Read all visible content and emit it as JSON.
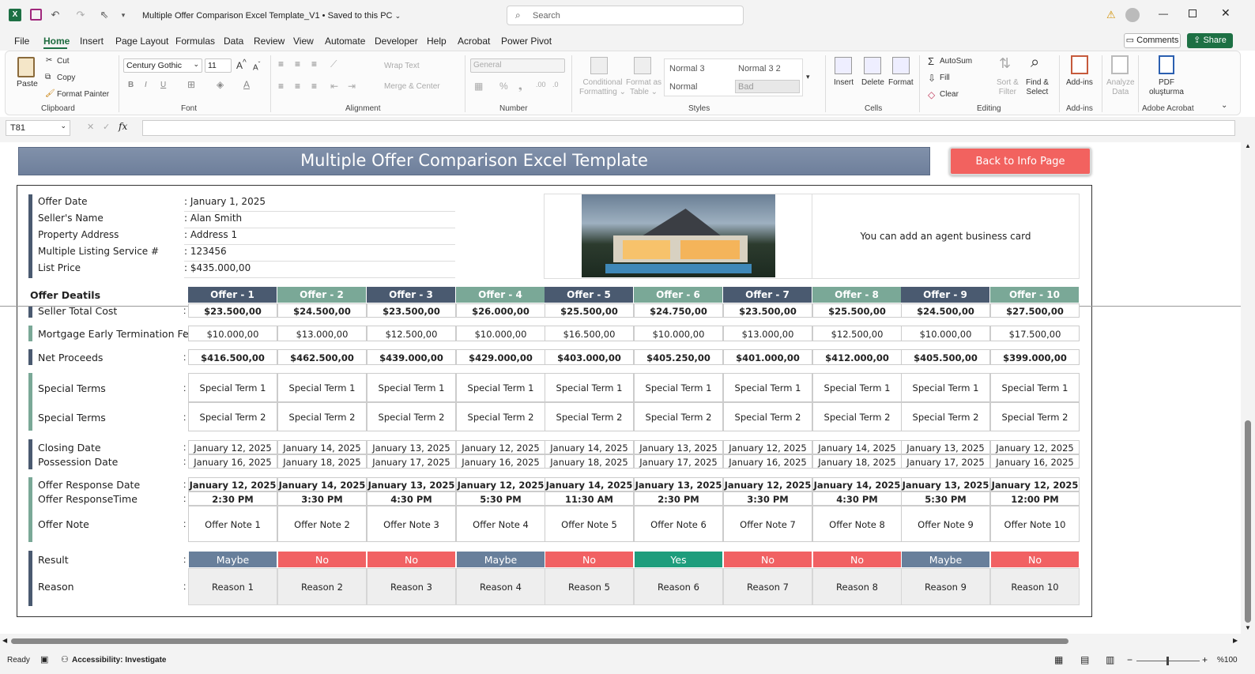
{
  "titlebar": {
    "doc_title": "Multiple Offer Comparison Excel Template_V1",
    "saved_status": "Saved to this PC",
    "search_placeholder": "Search"
  },
  "menu": [
    "File",
    "Home",
    "Insert",
    "Page Layout",
    "Formulas",
    "Data",
    "Review",
    "View",
    "Automate",
    "Developer",
    "Help",
    "Acrobat",
    "Power Pivot"
  ],
  "menu_active": "Home",
  "comments_label": "Comments",
  "share_label": "Share",
  "ribbon": {
    "clipboard": {
      "paste": "Paste",
      "cut": "Cut",
      "copy": "Copy",
      "format_painter": "Format Painter",
      "group": "Clipboard"
    },
    "font": {
      "name": "Century Gothic",
      "size": "11",
      "group": "Font"
    },
    "alignment": {
      "wrap": "Wrap Text",
      "merge": "Merge & Center",
      "group": "Alignment"
    },
    "number": {
      "format": "General",
      "group": "Number"
    },
    "styles": {
      "cond1": "Conditional",
      "cond2": "Formatting",
      "fmt1": "Format as",
      "fmt2": "Table",
      "s1": "Normal 3",
      "s2": "Normal 3 2",
      "s3": "Normal",
      "s4": "Bad",
      "group": "Styles"
    },
    "cells": {
      "insert": "Insert",
      "delete": "Delete",
      "format": "Format",
      "group": "Cells"
    },
    "editing": {
      "autosum": "AutoSum",
      "fill": "Fill",
      "clear": "Clear",
      "sort1": "Sort &",
      "sort2": "Filter",
      "find1": "Find &",
      "find2": "Select",
      "group": "Editing"
    },
    "addins": {
      "label": "Add-ins",
      "group": "Add-ins"
    },
    "analyze": {
      "l1": "Analyze",
      "l2": "Data"
    },
    "acrobat": {
      "l1": "PDF",
      "l2": "oluşturma",
      "group": "Adobe Acrobat"
    }
  },
  "namebox": "T81",
  "fx": "fx",
  "sheet": {
    "banner_title": "Multiple Offer Comparison Excel Template",
    "back_button": "Back to Info Page",
    "agent_card_text": "You can add an agent business card",
    "info": [
      {
        "label": "Offer Date",
        "value": ": January 1, 2025"
      },
      {
        "label": "Seller's Name",
        "value": ": Alan Smith"
      },
      {
        "label": "Property Address",
        "value": ": Address 1"
      },
      {
        "label": "Multiple Listing Service #",
        "value": ": 123456"
      },
      {
        "label": "List Price",
        "value": ": $435.000,00"
      }
    ],
    "offer_details_label": "Offer Deatils",
    "offers": [
      "Offer - 1",
      "Offer - 2",
      "Offer - 3",
      "Offer - 4",
      "Offer - 5",
      "Offer - 6",
      "Offer - 7",
      "Offer - 8",
      "Offer - 9",
      "Offer - 10"
    ],
    "colors": {
      "dark": "#4a5a70",
      "teal": "#7aa897",
      "banner": "#7a8aa5",
      "red": "#f16163",
      "green": "#1e9d7c",
      "maybe": "#687f9b"
    },
    "rows": {
      "seller_total_cost": {
        "label": "Seller Total Cost",
        "values": [
          "$23.500,00",
          "$24.500,00",
          "$23.500,00",
          "$26.000,00",
          "$25.500,00",
          "$24.750,00",
          "$23.500,00",
          "$25.500,00",
          "$24.500,00",
          "$27.500,00"
        ]
      },
      "mortgage_fee": {
        "label": "Mortgage Early Termination Fee",
        "values": [
          "$10.000,00",
          "$13.000,00",
          "$12.500,00",
          "$10.000,00",
          "$16.500,00",
          "$10.000,00",
          "$13.000,00",
          "$12.500,00",
          "$10.000,00",
          "$17.500,00"
        ]
      },
      "net_proceeds": {
        "label": "Net Proceeds",
        "values": [
          "$416.500,00",
          "$462.500,00",
          "$439.000,00",
          "$429.000,00",
          "$403.000,00",
          "$405.250,00",
          "$401.000,00",
          "$412.000,00",
          "$405.500,00",
          "$399.000,00"
        ]
      },
      "special1": {
        "label": "Special Terms",
        "values": [
          "Special Term 1",
          "Special Term 1",
          "Special Term 1",
          "Special Term 1",
          "Special Term 1",
          "Special Term 1",
          "Special Term 1",
          "Special Term 1",
          "Special Term 1",
          "Special Term 1"
        ]
      },
      "special2": {
        "label": "Special Terms",
        "values": [
          "Special Term 2",
          "Special Term 2",
          "Special Term 2",
          "Special Term 2",
          "Special Term 2",
          "Special Term 2",
          "Special Term 2",
          "Special Term 2",
          "Special Term 2",
          "Special Term 2"
        ]
      },
      "closing": {
        "label": "Closing Date",
        "values": [
          "January 12, 2025",
          "January 14, 2025",
          "January 13, 2025",
          "January 12, 2025",
          "January 14, 2025",
          "January 13, 2025",
          "January 12, 2025",
          "January 14, 2025",
          "January 13, 2025",
          "January 12, 2025"
        ]
      },
      "possession": {
        "label": "Possession Date",
        "values": [
          "January 16, 2025",
          "January 18, 2025",
          "January 17, 2025",
          "January 16, 2025",
          "January 18, 2025",
          "January 17, 2025",
          "January 16, 2025",
          "January 18, 2025",
          "January 17, 2025",
          "January 16, 2025"
        ]
      },
      "response_date": {
        "label": "Offer Response Date",
        "values": [
          "January 12, 2025",
          "January 14, 2025",
          "January 13, 2025",
          "January 12, 2025",
          "January 14, 2025",
          "January 13, 2025",
          "January 12, 2025",
          "January 14, 2025",
          "January 13, 2025",
          "January 12, 2025"
        ]
      },
      "response_time": {
        "label": "Offer ResponseTime",
        "values": [
          "2:30 PM",
          "3:30 PM",
          "4:30 PM",
          "5:30 PM",
          "11:30 AM",
          "2:30 PM",
          "3:30 PM",
          "4:30 PM",
          "5:30 PM",
          "12:00 PM"
        ]
      },
      "offer_note": {
        "label": "Offer Note",
        "values": [
          "Offer Note 1",
          "Offer Note 2",
          "Offer Note 3",
          "Offer Note 4",
          "Offer Note 5",
          "Offer Note 6",
          "Offer Note 7",
          "Offer Note 8",
          "Offer Note 9",
          "Offer Note 10"
        ]
      },
      "result": {
        "label": "Result",
        "values": [
          "Maybe",
          "No",
          "No",
          "Maybe",
          "No",
          "Yes",
          "No",
          "No",
          "Maybe",
          "No"
        ]
      },
      "reason": {
        "label": "Reason",
        "values": [
          "Reason 1",
          "Reason 2",
          "Reason 3",
          "Reason 4",
          "Reason 5",
          "Reason 6",
          "Reason 7",
          "Reason 8",
          "Reason 9",
          "Reason 10"
        ]
      }
    }
  },
  "status": {
    "ready": "Ready",
    "accessibility": "Accessibility: Investigate",
    "zoom": "%100"
  }
}
